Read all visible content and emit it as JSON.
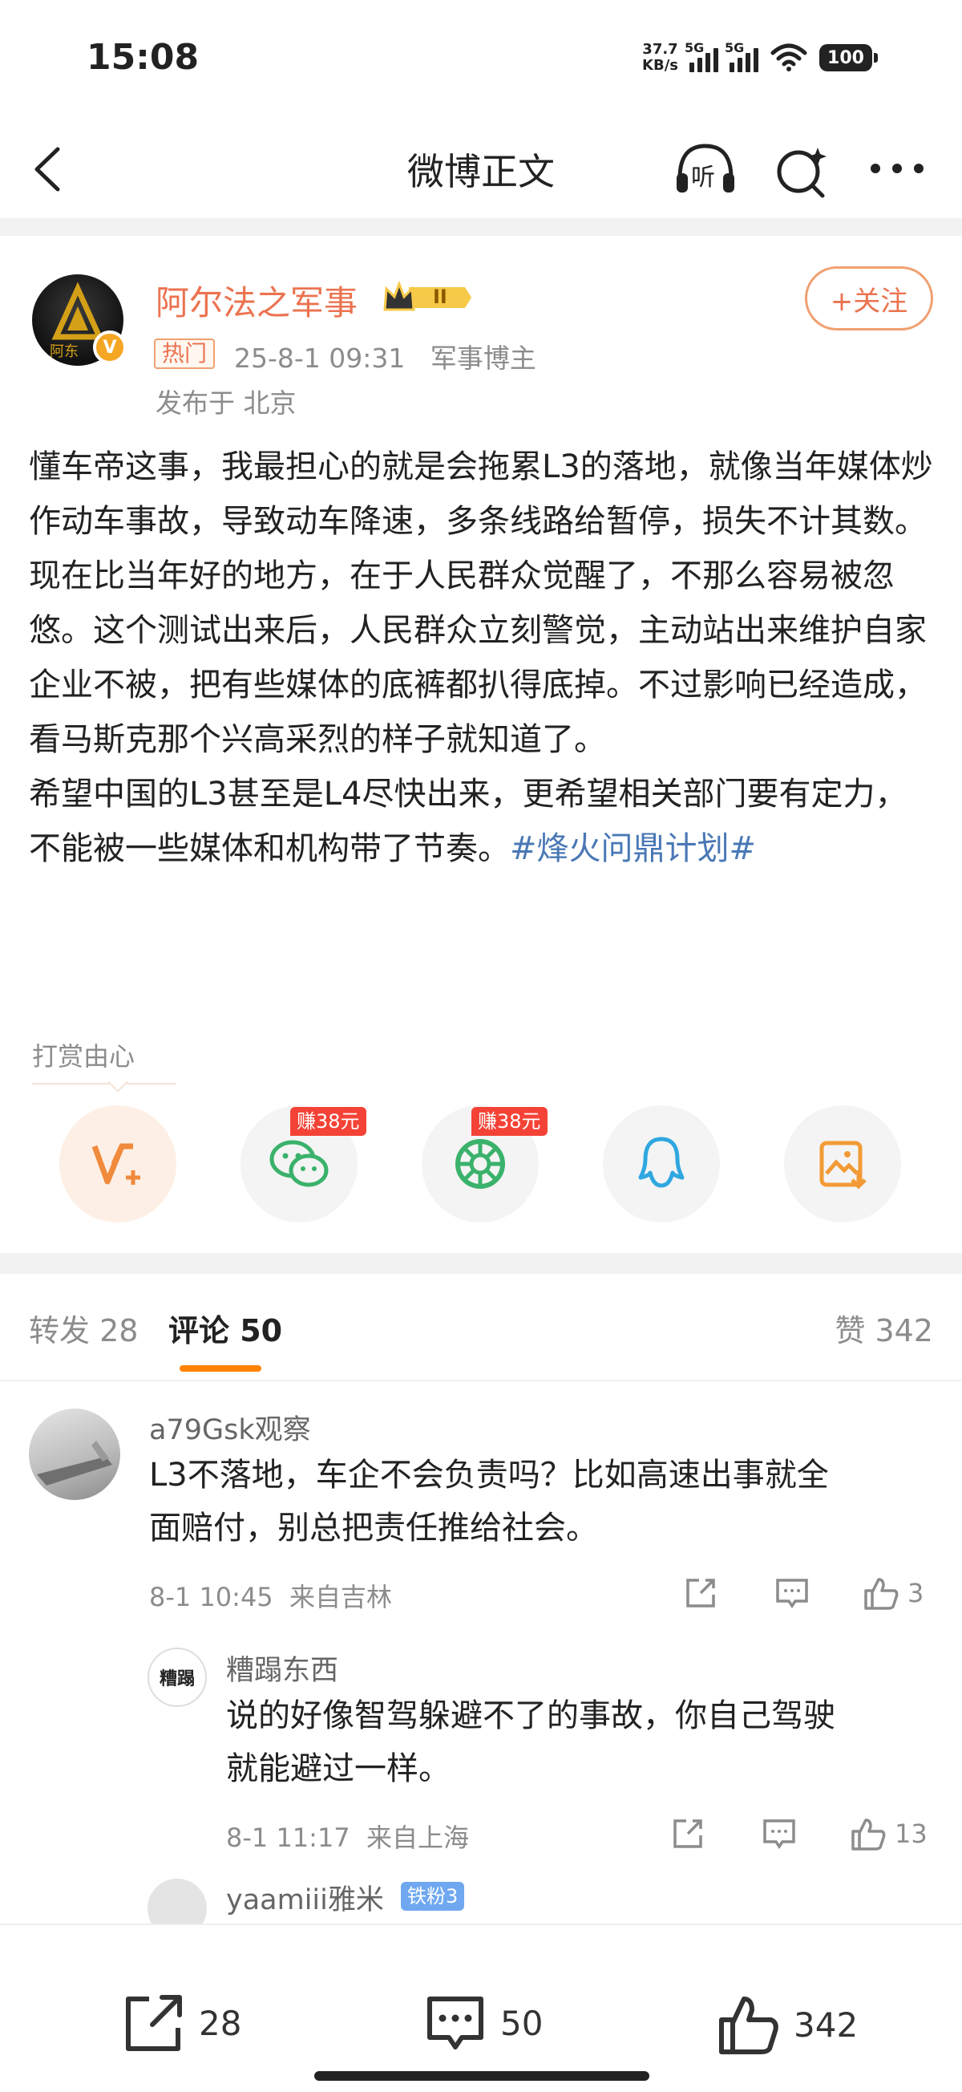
{
  "status_bar": {
    "time": "15:08",
    "net_speed_value": "37.7",
    "net_speed_unit": "KB/s",
    "signal1_label": "5G",
    "signal2_label": "5G",
    "battery": "100",
    "icons": [
      "signal-icon",
      "signal-icon",
      "wifi-icon",
      "battery-icon"
    ]
  },
  "nav": {
    "title": "微博正文",
    "listen_label": "听",
    "icons": [
      "back-icon",
      "headphones-icon",
      "search-sparkle-icon",
      "more-icon"
    ]
  },
  "post": {
    "author": "阿尔法之军事",
    "avatar_text": "阿东",
    "verified_mark": "V",
    "level_badge": "II",
    "hot_tag": "热门",
    "meta": "25-8-1 09:31   军事博主",
    "location": "发布于 北京",
    "follow_label": "+关注",
    "paragraphs": [
      "懂车帝这事，我最担心的就是会拖累L3的落地，就像当年媒体炒作动车事故，导致动车降速，多条线路给暂停，损失不计其数。",
      "现在比当年好的地方，在于人民群众觉醒了，不那么容易被忽悠。这个测试出来后，人民群众立刻警觉，主动站出来维护自家企业不被，把有些媒体的底裤都扒得底掉。不过影响已经造成，看马斯克那个兴高采烈的样子就知道了。",
      "希望中国的L3甚至是L4尽快出来，更希望相关部门要有定力，不能被一些媒体和机构带了节奏。"
    ],
    "hashtag": "#烽火问鼎计划#"
  },
  "reward": {
    "label": "打赏由心",
    "earn_badge_1": "赚38元",
    "earn_badge_2": "赚38元",
    "share_icons": [
      "v-plus-icon",
      "wechat-icon",
      "moments-icon",
      "qq-icon",
      "save-image-icon"
    ]
  },
  "tabs": {
    "repost": "转发 28",
    "comments": "评论 50",
    "likes": "赞 342",
    "active": "comments"
  },
  "comments": [
    {
      "user": "a79Gsk观察",
      "text_line1": "L3不落地，车企不会负责吗？比如高速出事就全",
      "text_line2": "面赔付，别总把责任推给社会。",
      "meta": "8-1 10:45  来自吉林",
      "likes": "3"
    },
    {
      "user": "糟蹋东西",
      "avatar_text": "糟蹋",
      "text_line1": "说的好像智驾躲避不了的事故，你自己驾驶",
      "text_line2": "就能避过一样。",
      "meta": "8-1 11:17  来自上海",
      "likes": "13"
    },
    {
      "user": "yaamiii雅米",
      "badge": "铁粉3"
    }
  ],
  "bottom_bar": {
    "reposts": "28",
    "comments": "50",
    "likes": "342"
  },
  "colors": {
    "accent_orange": "#eb7350",
    "tab_underline": "#ff8200",
    "hashtag_blue": "#4a78b5",
    "earn_red": "#f44336"
  }
}
